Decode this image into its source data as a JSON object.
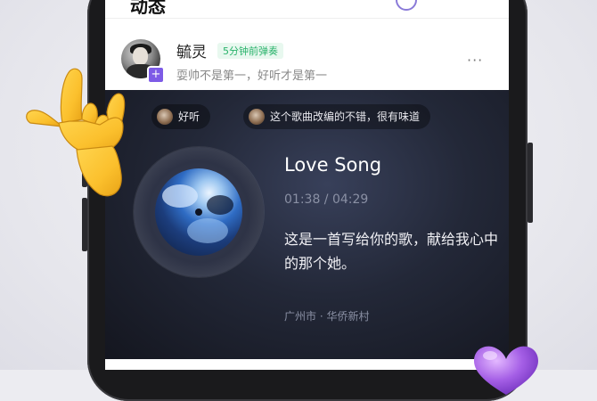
{
  "header": {
    "title": "动态"
  },
  "post": {
    "username": "毓灵",
    "time_badge": "5分钟前弹奏",
    "signature": "耍帅不是第一，好听才是第一",
    "more": "···",
    "plus": "+"
  },
  "comments": [
    {
      "text": "好听"
    },
    {
      "text": "这个歌曲改编的不错，很有味道"
    }
  ],
  "song": {
    "title": "Love Song",
    "time": "01:38 / 04:29",
    "description": "这是一首写给你的歌，献给我心中的那个她。",
    "location": "广州市 · 华侨新村"
  },
  "colors": {
    "accent": "#7d5be6",
    "badge_green": "#28b26a",
    "card_bg": "#232838"
  },
  "icons": [
    "rock-hand-emoji",
    "purple-heart-emoji",
    "plus-icon",
    "more-icon"
  ]
}
